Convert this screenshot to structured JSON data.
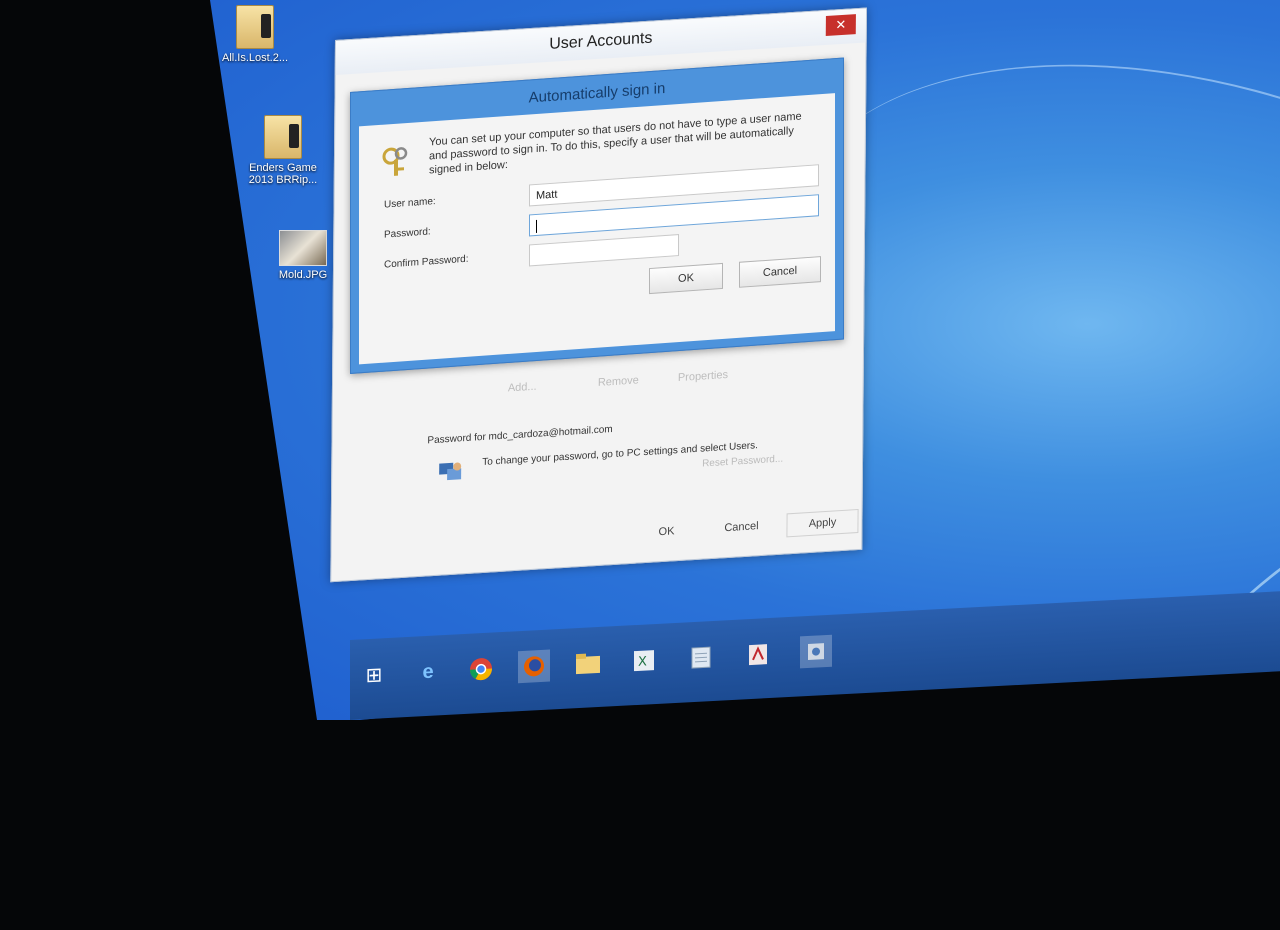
{
  "desktop": {
    "icons": [
      {
        "label": "All.Is.Lost.2...",
        "icon": "folder-icon"
      },
      {
        "label": "Enders Game 2013 BRRip...",
        "icon": "folder-icon"
      },
      {
        "label": "Mold.JPG",
        "icon": "image-icon"
      }
    ]
  },
  "user_accounts": {
    "title": "User Accounts",
    "close": "✕",
    "faded_buttons": [
      "Add...",
      "Remove",
      "Properties"
    ],
    "password_info": "Password for mdc_cardoza@hotmail.com",
    "password_tip": "To change your password, go to PC settings and select Users.",
    "reset_password": "Reset Password...",
    "buttons": {
      "ok": "OK",
      "cancel": "Cancel",
      "apply": "Apply"
    }
  },
  "auto_signin": {
    "title": "Automatically sign in",
    "info": "You can set up your computer so that users do not have to type a user name and password to sign in. To do this, specify a user that will be automatically signed in below:",
    "username_label": "User name:",
    "username_value": "Matt",
    "password_label": "Password:",
    "confirm_label": "Confirm Password:",
    "ok": "OK",
    "cancel": "Cancel"
  },
  "taskbar": {
    "items": [
      "start-icon",
      "internet-explorer-icon",
      "chrome-icon",
      "firefox-icon",
      "file-explorer-icon",
      "excel-icon",
      "notepad-icon",
      "acrobat-icon",
      "control-panel-icon"
    ]
  },
  "colors": {
    "desktop_blue": "#2b73d8",
    "dialog_frame": "#4d93dc",
    "close_red": "#c7302b"
  }
}
